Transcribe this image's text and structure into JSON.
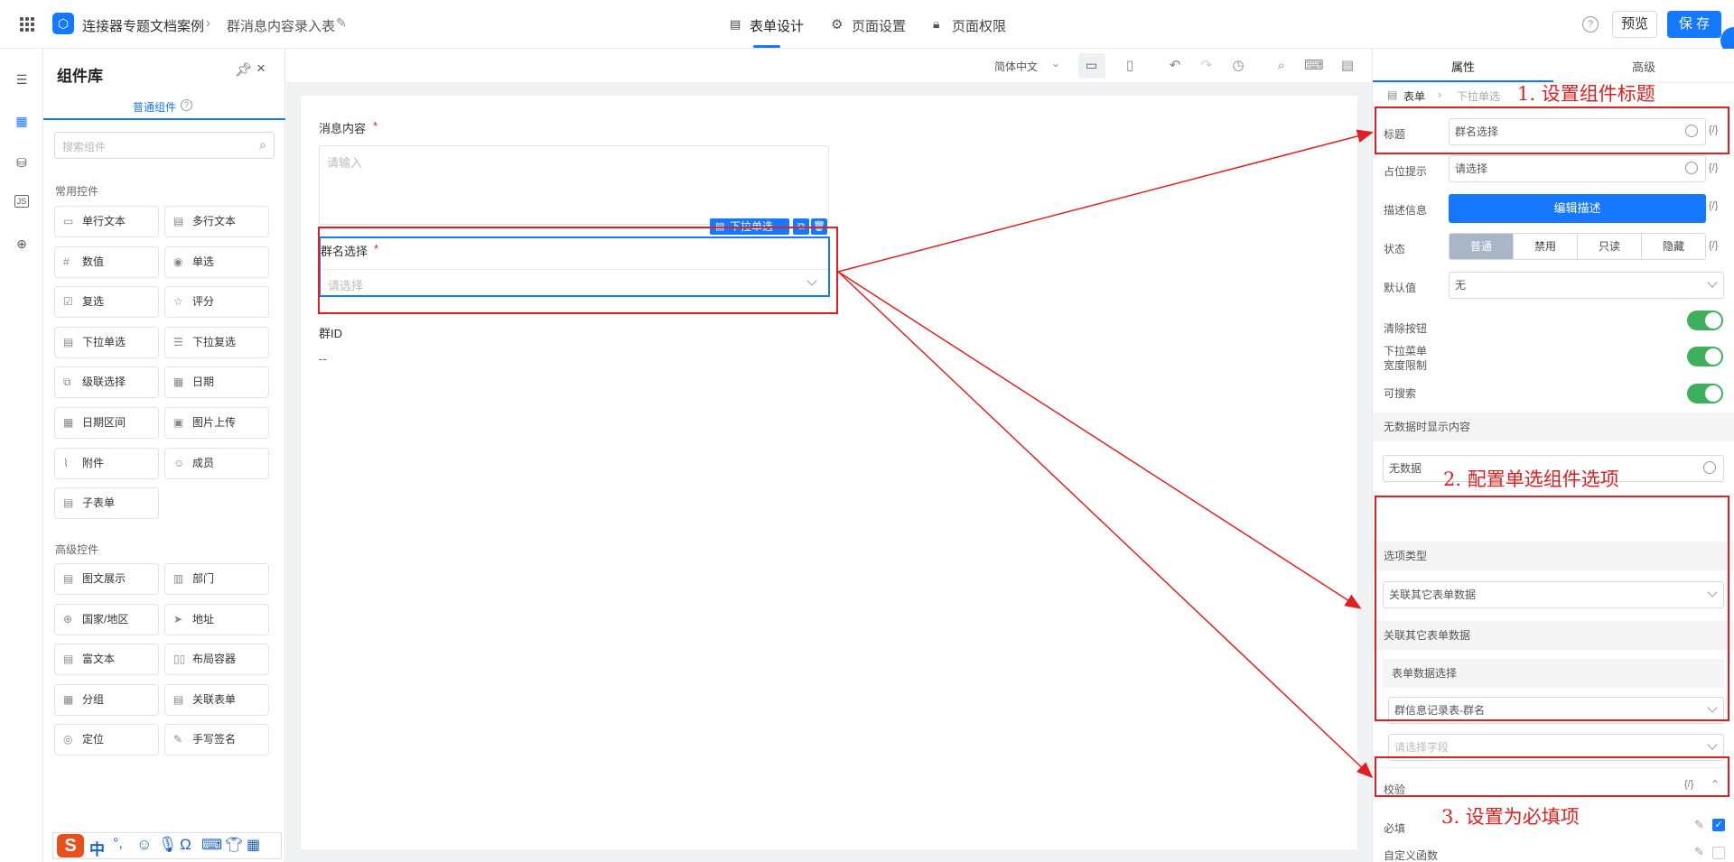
{
  "topbar": {
    "app_name": "连接器专题文档案例",
    "page_name": "群消息内容录入表",
    "tabs": [
      {
        "label": "表单设计"
      },
      {
        "label": "页面设置"
      },
      {
        "label": "页面权限"
      }
    ],
    "preview_label": "预览",
    "save_label": "保 存"
  },
  "library": {
    "title": "组件库",
    "tab_label": "普通组件",
    "search_placeholder": "搜索组件",
    "common_title": "常用控件",
    "common": [
      "单行文本",
      "多行文本",
      "数值",
      "单选",
      "复选",
      "评分",
      "下拉单选",
      "下拉复选",
      "级联选择",
      "日期",
      "日期区间",
      "图片上传",
      "附件",
      "成员",
      "子表单"
    ],
    "advanced_title": "高级控件",
    "advanced": [
      "图文展示",
      "部门",
      "国家/地区",
      "地址",
      "富文本",
      "布局容器",
      "分组",
      "关联表单",
      "定位",
      "手写签名"
    ]
  },
  "canvas_toolbar": {
    "language": "简体中文"
  },
  "form": {
    "field1_label": "消息内容",
    "field1_placeholder": "请输入",
    "selected_tag": "下拉单选",
    "field2_label": "群名选择",
    "field2_placeholder": "请选择",
    "field3_label": "群ID",
    "field3_value": "--"
  },
  "props": {
    "tabs": [
      "属性",
      "高级"
    ],
    "breadcrumb_root": "表单",
    "breadcrumb_current": "下拉单选",
    "title_label": "标题",
    "title_value": "群名选择",
    "placeholder_label": "占位提示",
    "placeholder_value": "请选择",
    "desc_label": "描述信息",
    "desc_button": "编辑描述",
    "state_label": "状态",
    "states": [
      "普通",
      "禁用",
      "只读",
      "隐藏"
    ],
    "default_label": "默认值",
    "default_value": "无",
    "clear_label": "清除按钮",
    "width_label_1": "下拉菜单",
    "width_label_2": "宽度限制",
    "searchable_label": "可搜索",
    "nodata_section": "无数据时显示内容",
    "nodata_value": "无数据",
    "option_type_section": "选项类型",
    "option_type_value": "关联其它表单数据",
    "linked_section": "关联其它表单数据",
    "form_data_select": "表单数据选择",
    "linked_form_value": "群信息记录表-群名",
    "field_placeholder": "请选择字段",
    "validation_section": "校验",
    "required_label": "必填",
    "custom_func_label": "自定义函数",
    "code_symbol": "{/}"
  },
  "annotations": {
    "a1": "1. 设置组件标题",
    "a2": "2. 配置单选组件选项",
    "a3": "3. 设置为必填项"
  },
  "ime": {
    "logo": "S",
    "lang": "中"
  },
  "colors": {
    "accent": "#1677ff",
    "annotation": "#e02020",
    "toggle_on": "#3eaf5c"
  }
}
